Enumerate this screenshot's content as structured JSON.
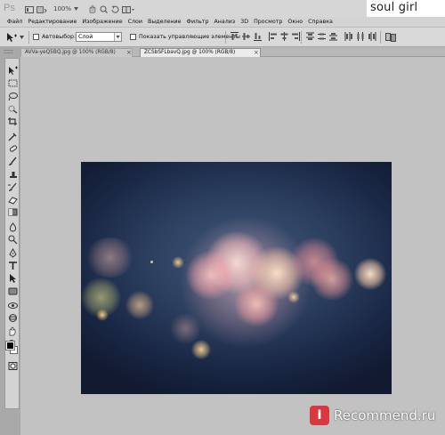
{
  "app": {
    "logo": "Ps",
    "zoom_label": "100%",
    "watermark_title": "soul girl"
  },
  "menu": {
    "items": [
      {
        "label": "Файл"
      },
      {
        "label": "Редактирование"
      },
      {
        "label": "Изображение"
      },
      {
        "label": "Слои"
      },
      {
        "label": "Выделение"
      },
      {
        "label": "Фильтр"
      },
      {
        "label": "Анализ"
      },
      {
        "label": "3D"
      },
      {
        "label": "Просмотр"
      },
      {
        "label": "Окно"
      },
      {
        "label": "Справка"
      }
    ]
  },
  "options": {
    "autoselect_label": "Автовыбор:",
    "autoselect_value": "Слой",
    "show_controls_label": "Показать управляющие элементы"
  },
  "tabs": [
    {
      "label": "AVVa-yeQ5BQ.jpg @ 100% (RGB/8)",
      "close": "×"
    },
    {
      "label": "ZCSbSFLbavQ.jpg @ 100% (RGB/8)",
      "close": "×"
    }
  ],
  "tools": [
    "move-tool-icon",
    "marquee-tool-icon",
    "lasso-tool-icon",
    "quick-select-tool-icon",
    "crop-tool-icon",
    "eyedropper-tool-icon",
    "healing-brush-tool-icon",
    "brush-tool-icon",
    "clone-stamp-tool-icon",
    "history-brush-tool-icon",
    "eraser-tool-icon",
    "gradient-tool-icon",
    "blur-tool-icon",
    "dodge-tool-icon",
    "pen-tool-icon",
    "type-tool-icon",
    "path-selection-tool-icon",
    "shape-tool-icon",
    "3d-rotate-tool-icon",
    "3d-orbit-tool-icon",
    "hand-tool-icon",
    "zoom-tool-icon"
  ],
  "badge": {
    "letter": "I",
    "text": "Recommend.ru"
  },
  "colors": {
    "badge_red": "#d8383e",
    "canvas_dark": "#111a30",
    "canvas_mid": "#41587a"
  }
}
